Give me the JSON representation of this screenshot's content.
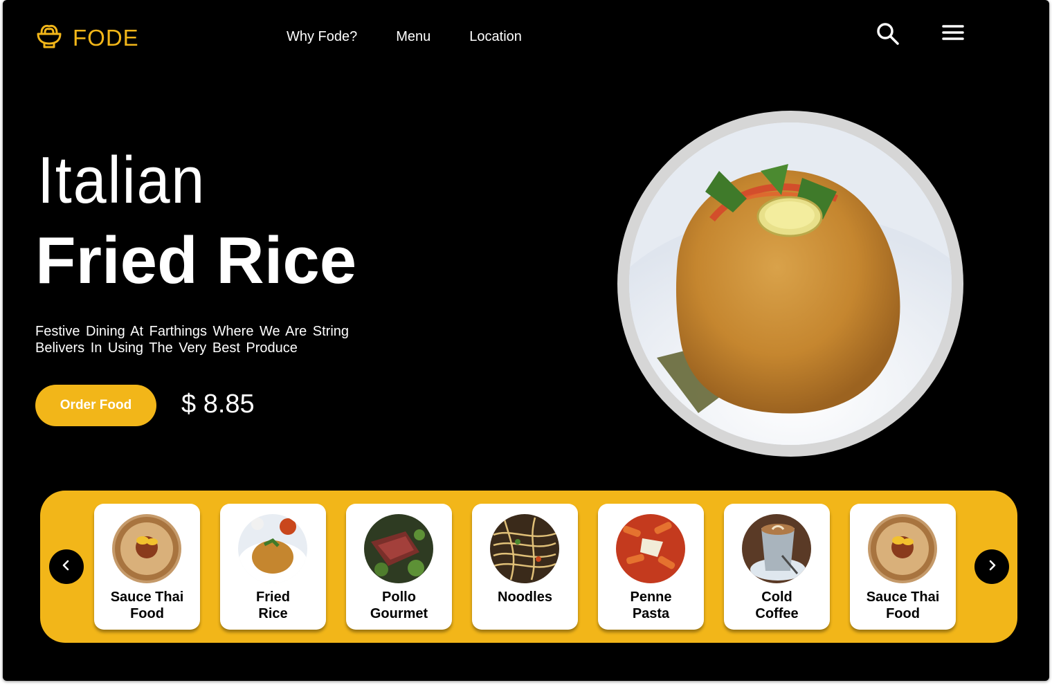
{
  "brand": {
    "name": "FODE",
    "icon": "bowl-icon",
    "color": "#f2b619"
  },
  "nav": {
    "items": [
      "Why Fode?",
      "Menu",
      "Location"
    ]
  },
  "header_icons": [
    "search-icon",
    "hamburger-menu-icon"
  ],
  "hero": {
    "subtitle": "Italian",
    "title": "Fried Rice",
    "description": "Festive  Dining  At  Farthings Where We Are String Belivers In Using The Very Best Produce",
    "order_button": "Order Food",
    "price": "$ 8.85"
  },
  "carousel": {
    "prev_icon": "chevron-left-icon",
    "next_icon": "chevron-right-icon",
    "items": [
      {
        "name": "Sauce Thai\nFood"
      },
      {
        "name": "Fried\nRice"
      },
      {
        "name": "Pollo\nGourmet"
      },
      {
        "name": "Noodles"
      },
      {
        "name": "Penne\nPasta"
      },
      {
        "name": "Cold\nCoffee"
      },
      {
        "name": "Sauce Thai\nFood"
      }
    ]
  },
  "colors": {
    "accent": "#f2b619",
    "background": "#000000"
  }
}
